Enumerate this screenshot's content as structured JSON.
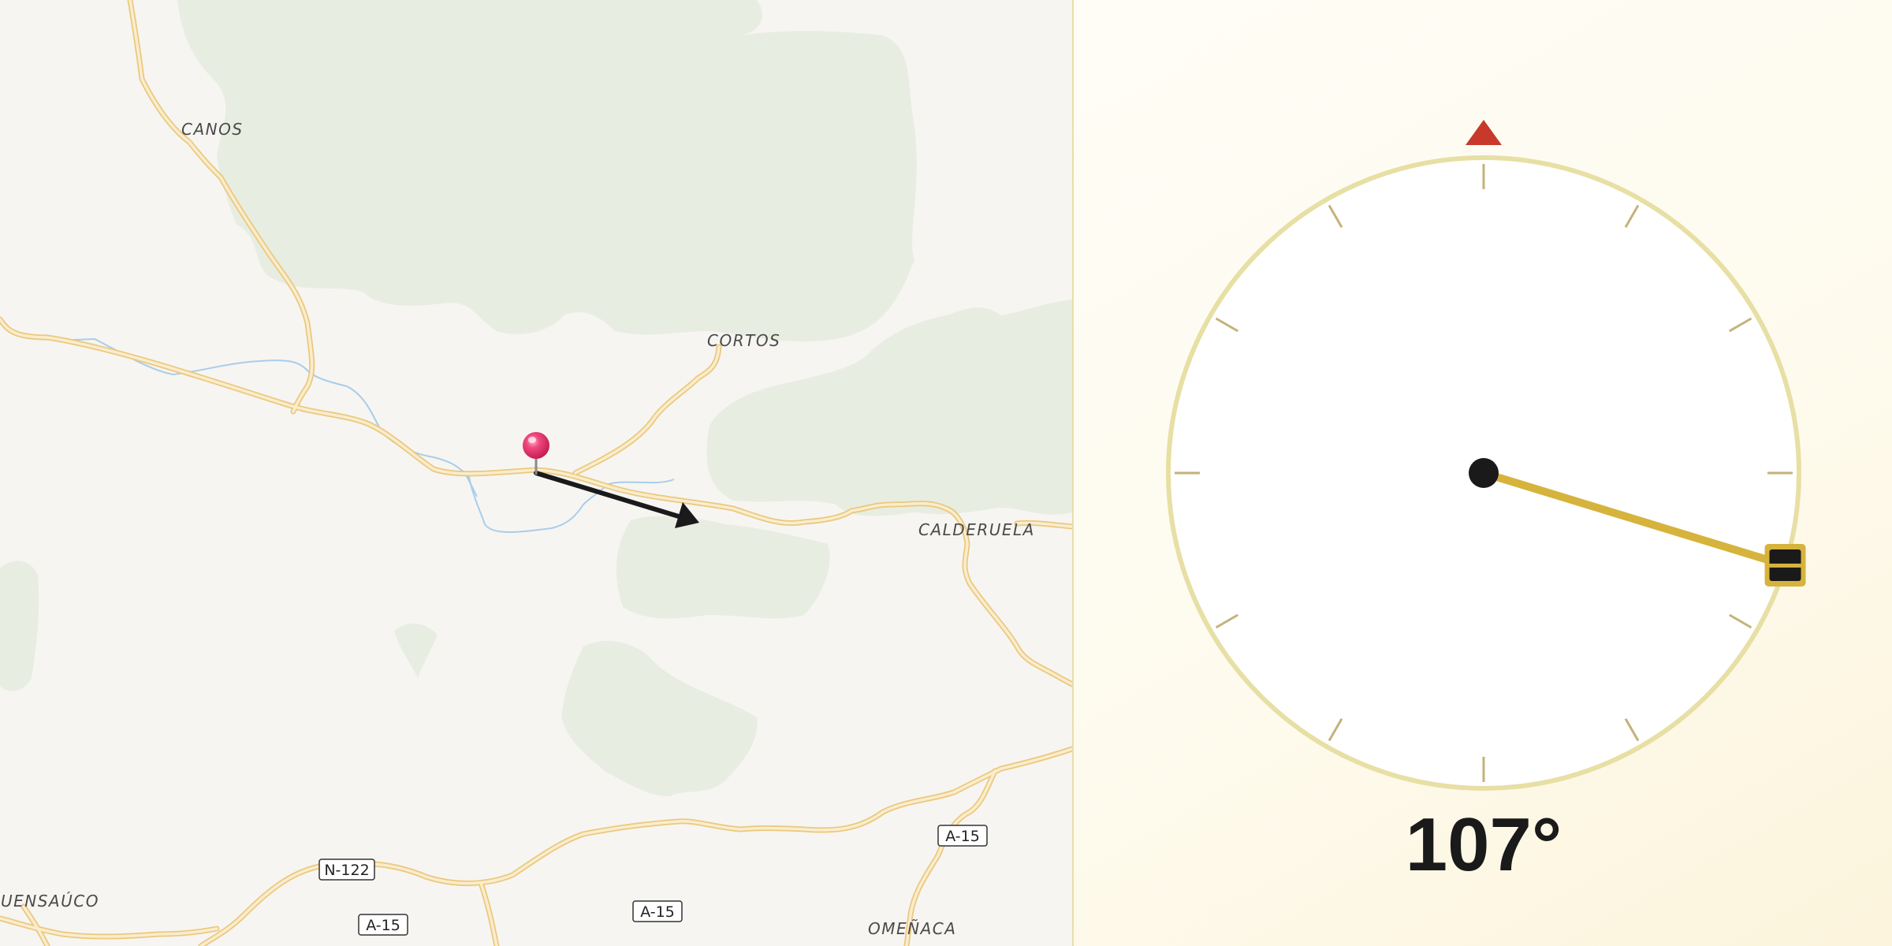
{
  "map": {
    "places": [
      {
        "id": "canos",
        "name": "CANOS"
      },
      {
        "id": "cortos",
        "name": "CORTOS"
      },
      {
        "id": "calderuela",
        "name": "CALDERUELA"
      },
      {
        "id": "omenaca",
        "name": "OMEÑACA"
      },
      {
        "id": "fuensauco",
        "name": "FUENSAÚCO"
      }
    ],
    "road_shields": [
      "N-122",
      "A-15",
      "A-15",
      "A-15"
    ],
    "marker": {
      "color": "#e8336f"
    },
    "direction_arrow": {
      "color": "#1a1a1a",
      "bearing_deg": 107
    }
  },
  "compass": {
    "bearing_deg": 107,
    "bearing_label": "107°",
    "north_marker_color": "#c8392b",
    "needle_color": "#d6b33c",
    "ring_color": "#e7dfa4"
  }
}
